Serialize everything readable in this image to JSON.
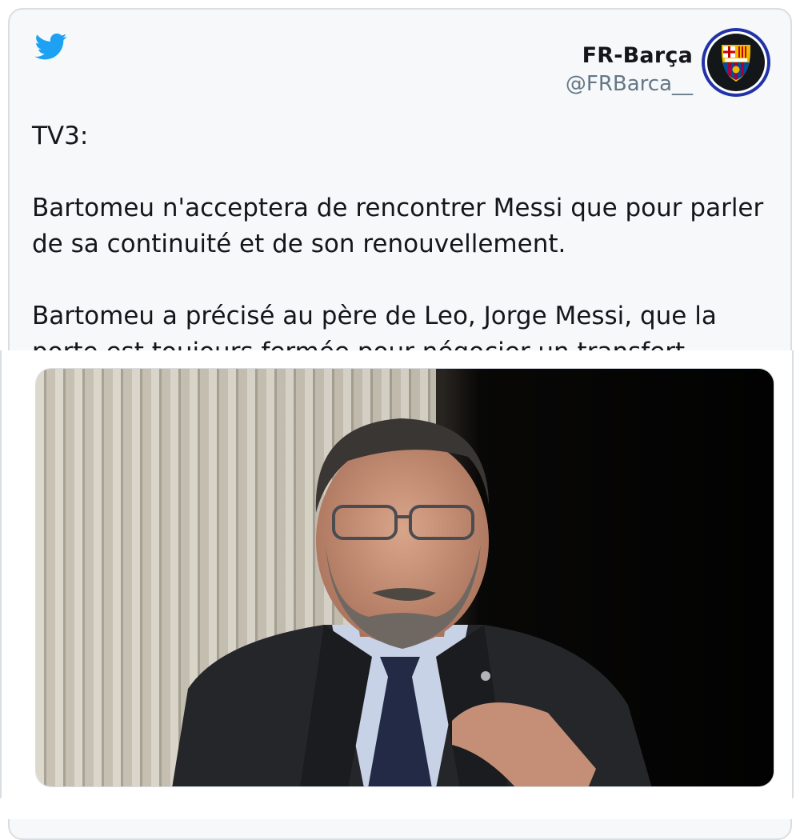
{
  "author": {
    "name": "FR-Barça",
    "handle": "@FRBarca__",
    "avatar_icon": "fc-barcelona-crest-icon"
  },
  "platform_icon": "twitter-bird-icon",
  "tweet": {
    "text": "TV3:\n\nBartomeu n'acceptera de rencontrer Messi que pour parler de sa continuité et de son renouvellement.\n\nBartomeu a précisé au père de Leo, Jorge Messi, que la porte est toujours fermée pour négocier un transfert."
  },
  "media": {
    "description_icon": "photo-man-with-glasses-icon"
  },
  "colors": {
    "twitter_blue": "#1da1f2",
    "card_bg": "#f6f8fa",
    "text": "#14171a",
    "muted": "#657786",
    "barca_blue": "#004d98",
    "barca_red": "#a50044",
    "barca_gold": "#edbb00"
  }
}
